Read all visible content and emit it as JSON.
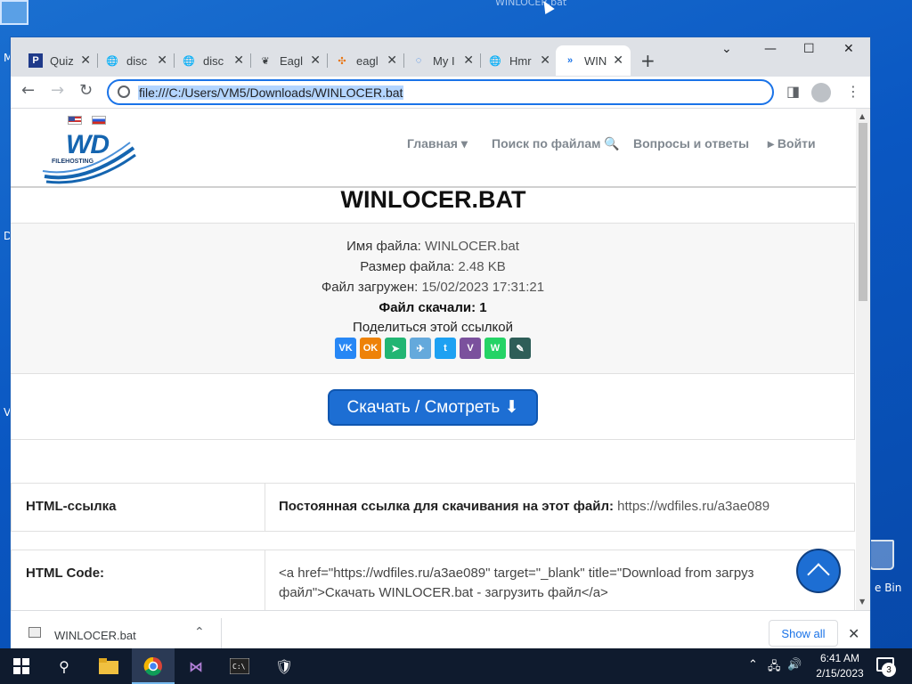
{
  "desktop": {
    "dragged_file": "WINLOCER.bat",
    "left_letters": [
      "M",
      "D",
      "V"
    ],
    "recycle_label": "e Bin"
  },
  "browser": {
    "tabs": [
      {
        "title": "Quiz",
        "favicon": "P",
        "favicon_bg": "#1f3a8a"
      },
      {
        "title": "disc",
        "favicon": "globe-icon"
      },
      {
        "title": "disc",
        "favicon": "globe-icon"
      },
      {
        "title": "Eagl",
        "favicon": "eagle-icon"
      },
      {
        "title": "eagl",
        "favicon": "orange-share-icon"
      },
      {
        "title": "My I",
        "favicon": "loading-icon"
      },
      {
        "title": "Hmr",
        "favicon": "globe-icon"
      },
      {
        "title": "WIN",
        "favicon": "double-chevron-icon",
        "active": true
      }
    ],
    "url": "file:///C:/Users/VM5/Downloads/WINLOCER.bat"
  },
  "site": {
    "menu": {
      "home": "Главная ▾",
      "search": "Поиск по файлам 🔍",
      "faq": "Вопросы и ответы",
      "login": "▸ Войти"
    },
    "logo_text": "WD",
    "logo_sub": "FILEHOSTING",
    "title": "WINLOCER.BAT",
    "info": {
      "name_label": "Имя файла:",
      "name_value": "WINLOCER.bat",
      "size_label": "Размер файла:",
      "size_value": "2.48 KB",
      "uploaded_label": "Файл загружен:",
      "uploaded_value": "15/02/2023 17:31:21",
      "downloads": "Файл скачали: 1",
      "share_label": "Поделиться этой ссылкой"
    },
    "share_buttons": [
      {
        "label": "VK",
        "color": "#2787f5"
      },
      {
        "label": "OK",
        "color": "#ee8208"
      },
      {
        "label": "➤",
        "color": "#22b573"
      },
      {
        "label": "✈",
        "color": "#64a9dc"
      },
      {
        "label": "t",
        "color": "#1da1f2"
      },
      {
        "label": "V",
        "color": "#7b519d"
      },
      {
        "label": "W",
        "color": "#25d366"
      },
      {
        "label": "✎",
        "color": "#2e5e58"
      }
    ],
    "download_button": "Скачать / Смотреть ⬇",
    "rows": {
      "html_link_key": "HTML-ссылка",
      "html_link_bold": "Постоянная ссылка для скачивания на этот файл:",
      "html_link_url": "https://wdfiles.ru/a3ae089",
      "html_code_key": "HTML Code:",
      "html_code_line1": "<a href=\"https://wdfiles.ru/a3ae089\" target=\"_blank\" title=\"Download from загруз",
      "html_code_line2": "файл\">Скачать WINLOCER.bat - загрузить файл</a>"
    }
  },
  "download_shelf": {
    "file": "WINLOCER.bat",
    "show_all": "Show all"
  },
  "taskbar": {
    "time": "6:41 AM",
    "date": "2/15/2023",
    "notifications": "3"
  },
  "colors": {
    "accent": "#1d6ed3",
    "desktop": "#0a57c2"
  }
}
